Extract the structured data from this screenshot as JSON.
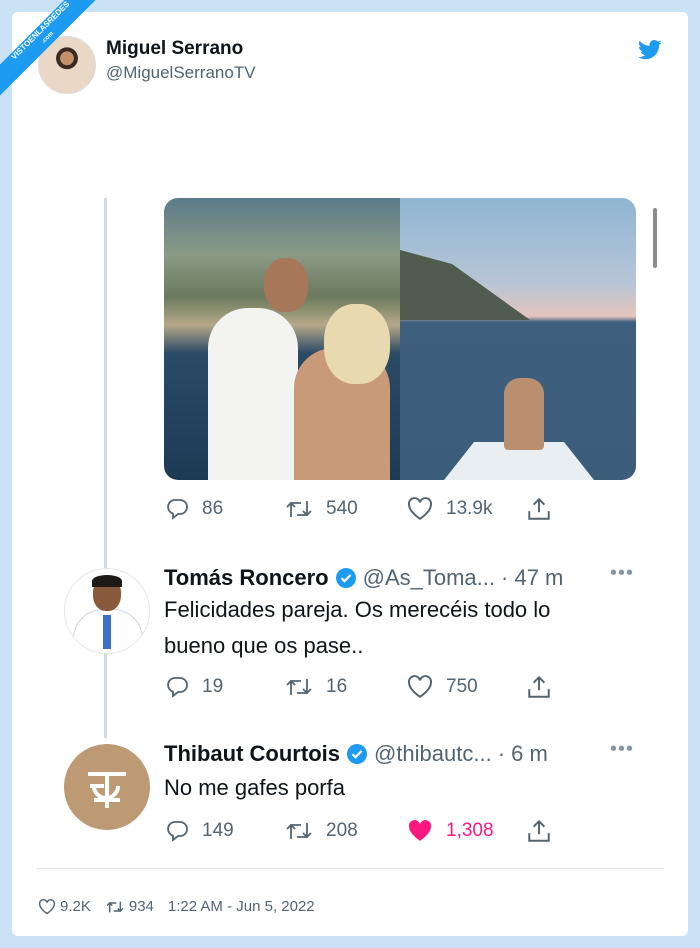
{
  "watermark": {
    "line1": "VISTOENLASREDES",
    "line2": ".com"
  },
  "author": {
    "name": "Miguel Serrano",
    "handle": "@MiguelSerranoTV"
  },
  "original_tweet": {
    "stats": {
      "replies": "86",
      "retweets": "540",
      "likes": "13.9k"
    }
  },
  "replies": [
    {
      "name": "Tomás Roncero",
      "handle": "@As_Toma...",
      "time": "· 47 m",
      "text_line1": "Felicidades pareja. Os merecéis todo lo",
      "text_line2": "bueno que os pase..",
      "stats": {
        "replies": "19",
        "retweets": "16",
        "likes": "750"
      }
    },
    {
      "name": "Thibaut Courtois",
      "handle": "@thibautc...",
      "time": "· 6 m",
      "text_line1": "No me gafes porfa",
      "stats": {
        "replies": "149",
        "retweets": "208",
        "likes": "1,308"
      }
    }
  ],
  "footer": {
    "likes": "9.2K",
    "retweets": "934",
    "timestamp": "1:22 AM - Jun 5, 2022"
  },
  "colors": {
    "twitter_blue": "#1d9bf0",
    "like_pink": "#f91880",
    "verified": "#1d9bf0",
    "background": "#c9e3f4"
  }
}
